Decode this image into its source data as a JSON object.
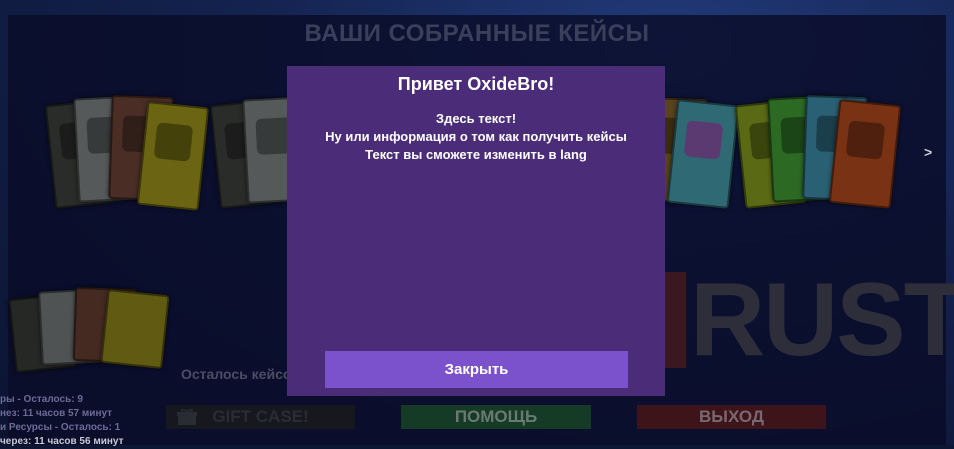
{
  "header": {
    "title": "ВАШИ СОБРАННЫЕ КЕЙСЫ"
  },
  "cases_footer": {
    "remaining_label": "Осталось кейсо"
  },
  "buttons": {
    "gift": "GIFT CASE!",
    "help": "ПОМОЩЬ",
    "exit": "ВЫХОД"
  },
  "status_lines": [
    "ры - Осталось: 9",
    "нез: 11 часов 57 минут",
    "и Ресурсы - Осталось: 1",
    "через: 11 часов 56 минут"
  ],
  "background_logo": "RUST",
  "nav": {
    "next_arrow": ">"
  },
  "modal": {
    "title": "Привет OxideBro!",
    "lines": [
      "Здесь текст!",
      "Ну или информация о том как получить кейсы",
      "Текст вы сможете изменить в lang"
    ],
    "close_label": "Закрыть"
  },
  "colors": {
    "modal_bg": "#4a2c78",
    "close_button": "#7c52cc",
    "help_button": "#153a26",
    "exit_button": "#3d141a"
  }
}
